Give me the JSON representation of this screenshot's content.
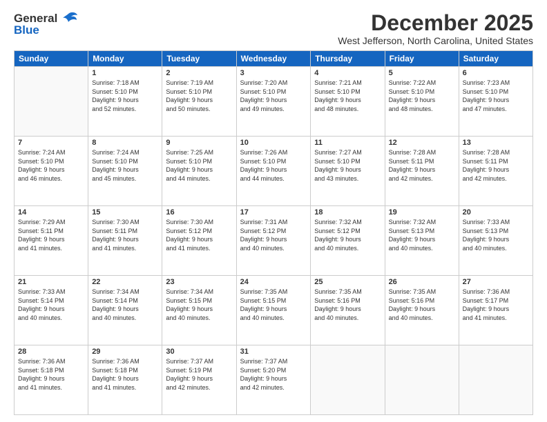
{
  "logo": {
    "general": "General",
    "blue": "Blue"
  },
  "title": "December 2025",
  "location": "West Jefferson, North Carolina, United States",
  "weekdays": [
    "Sunday",
    "Monday",
    "Tuesday",
    "Wednesday",
    "Thursday",
    "Friday",
    "Saturday"
  ],
  "weeks": [
    [
      {
        "day": "",
        "info": ""
      },
      {
        "day": "1",
        "info": "Sunrise: 7:18 AM\nSunset: 5:10 PM\nDaylight: 9 hours\nand 52 minutes."
      },
      {
        "day": "2",
        "info": "Sunrise: 7:19 AM\nSunset: 5:10 PM\nDaylight: 9 hours\nand 50 minutes."
      },
      {
        "day": "3",
        "info": "Sunrise: 7:20 AM\nSunset: 5:10 PM\nDaylight: 9 hours\nand 49 minutes."
      },
      {
        "day": "4",
        "info": "Sunrise: 7:21 AM\nSunset: 5:10 PM\nDaylight: 9 hours\nand 48 minutes."
      },
      {
        "day": "5",
        "info": "Sunrise: 7:22 AM\nSunset: 5:10 PM\nDaylight: 9 hours\nand 48 minutes."
      },
      {
        "day": "6",
        "info": "Sunrise: 7:23 AM\nSunset: 5:10 PM\nDaylight: 9 hours\nand 47 minutes."
      }
    ],
    [
      {
        "day": "7",
        "info": "Sunrise: 7:24 AM\nSunset: 5:10 PM\nDaylight: 9 hours\nand 46 minutes."
      },
      {
        "day": "8",
        "info": "Sunrise: 7:24 AM\nSunset: 5:10 PM\nDaylight: 9 hours\nand 45 minutes."
      },
      {
        "day": "9",
        "info": "Sunrise: 7:25 AM\nSunset: 5:10 PM\nDaylight: 9 hours\nand 44 minutes."
      },
      {
        "day": "10",
        "info": "Sunrise: 7:26 AM\nSunset: 5:10 PM\nDaylight: 9 hours\nand 44 minutes."
      },
      {
        "day": "11",
        "info": "Sunrise: 7:27 AM\nSunset: 5:10 PM\nDaylight: 9 hours\nand 43 minutes."
      },
      {
        "day": "12",
        "info": "Sunrise: 7:28 AM\nSunset: 5:11 PM\nDaylight: 9 hours\nand 42 minutes."
      },
      {
        "day": "13",
        "info": "Sunrise: 7:28 AM\nSunset: 5:11 PM\nDaylight: 9 hours\nand 42 minutes."
      }
    ],
    [
      {
        "day": "14",
        "info": "Sunrise: 7:29 AM\nSunset: 5:11 PM\nDaylight: 9 hours\nand 41 minutes."
      },
      {
        "day": "15",
        "info": "Sunrise: 7:30 AM\nSunset: 5:11 PM\nDaylight: 9 hours\nand 41 minutes."
      },
      {
        "day": "16",
        "info": "Sunrise: 7:30 AM\nSunset: 5:12 PM\nDaylight: 9 hours\nand 41 minutes."
      },
      {
        "day": "17",
        "info": "Sunrise: 7:31 AM\nSunset: 5:12 PM\nDaylight: 9 hours\nand 40 minutes."
      },
      {
        "day": "18",
        "info": "Sunrise: 7:32 AM\nSunset: 5:12 PM\nDaylight: 9 hours\nand 40 minutes."
      },
      {
        "day": "19",
        "info": "Sunrise: 7:32 AM\nSunset: 5:13 PM\nDaylight: 9 hours\nand 40 minutes."
      },
      {
        "day": "20",
        "info": "Sunrise: 7:33 AM\nSunset: 5:13 PM\nDaylight: 9 hours\nand 40 minutes."
      }
    ],
    [
      {
        "day": "21",
        "info": "Sunrise: 7:33 AM\nSunset: 5:14 PM\nDaylight: 9 hours\nand 40 minutes."
      },
      {
        "day": "22",
        "info": "Sunrise: 7:34 AM\nSunset: 5:14 PM\nDaylight: 9 hours\nand 40 minutes."
      },
      {
        "day": "23",
        "info": "Sunrise: 7:34 AM\nSunset: 5:15 PM\nDaylight: 9 hours\nand 40 minutes."
      },
      {
        "day": "24",
        "info": "Sunrise: 7:35 AM\nSunset: 5:15 PM\nDaylight: 9 hours\nand 40 minutes."
      },
      {
        "day": "25",
        "info": "Sunrise: 7:35 AM\nSunset: 5:16 PM\nDaylight: 9 hours\nand 40 minutes."
      },
      {
        "day": "26",
        "info": "Sunrise: 7:35 AM\nSunset: 5:16 PM\nDaylight: 9 hours\nand 40 minutes."
      },
      {
        "day": "27",
        "info": "Sunrise: 7:36 AM\nSunset: 5:17 PM\nDaylight: 9 hours\nand 41 minutes."
      }
    ],
    [
      {
        "day": "28",
        "info": "Sunrise: 7:36 AM\nSunset: 5:18 PM\nDaylight: 9 hours\nand 41 minutes."
      },
      {
        "day": "29",
        "info": "Sunrise: 7:36 AM\nSunset: 5:18 PM\nDaylight: 9 hours\nand 41 minutes."
      },
      {
        "day": "30",
        "info": "Sunrise: 7:37 AM\nSunset: 5:19 PM\nDaylight: 9 hours\nand 42 minutes."
      },
      {
        "day": "31",
        "info": "Sunrise: 7:37 AM\nSunset: 5:20 PM\nDaylight: 9 hours\nand 42 minutes."
      },
      {
        "day": "",
        "info": ""
      },
      {
        "day": "",
        "info": ""
      },
      {
        "day": "",
        "info": ""
      }
    ]
  ]
}
